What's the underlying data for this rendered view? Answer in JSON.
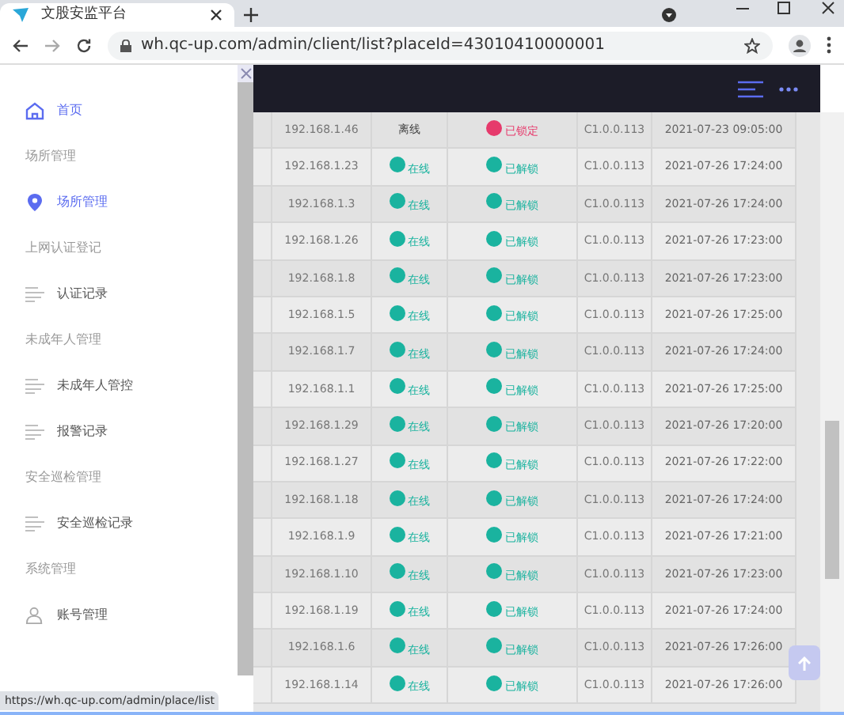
{
  "browser": {
    "tab_title": "文股安监平台",
    "url": "wh.qc-up.com/admin/client/list?placeId=43010410000001",
    "status_url": "https://wh.qc-up.com/admin/place/list"
  },
  "sidebar": {
    "items": [
      {
        "kind": "link",
        "label": "首页",
        "active": true
      },
      {
        "kind": "group",
        "label": "场所管理"
      },
      {
        "kind": "link",
        "label": "场所管理",
        "active": true
      },
      {
        "kind": "group",
        "label": "上网认证登记"
      },
      {
        "kind": "link",
        "label": "认证记录",
        "active": false
      },
      {
        "kind": "group",
        "label": "未成年人管理"
      },
      {
        "kind": "link",
        "label": "未成年人管控",
        "active": false
      },
      {
        "kind": "link",
        "label": "报警记录",
        "active": false
      },
      {
        "kind": "group",
        "label": "安全巡检管理"
      },
      {
        "kind": "link",
        "label": "安全巡检记录",
        "active": false
      },
      {
        "kind": "group",
        "label": "系统管理"
      },
      {
        "kind": "link",
        "label": "账号管理",
        "active": false
      }
    ]
  },
  "table": {
    "rows": [
      {
        "ip": "192.168.1.46",
        "status": "离线",
        "online": false,
        "lock": "已锁定",
        "locked": true,
        "version": "C1.0.0.113",
        "time": "2021-07-23 09:05:00"
      },
      {
        "ip": "192.168.1.23",
        "status": "在线",
        "online": true,
        "lock": "已解锁",
        "locked": false,
        "version": "C1.0.0.113",
        "time": "2021-07-26 17:24:00"
      },
      {
        "ip": "192.168.1.3",
        "status": "在线",
        "online": true,
        "lock": "已解锁",
        "locked": false,
        "version": "C1.0.0.113",
        "time": "2021-07-26 17:24:00"
      },
      {
        "ip": "192.168.1.26",
        "status": "在线",
        "online": true,
        "lock": "已解锁",
        "locked": false,
        "version": "C1.0.0.113",
        "time": "2021-07-26 17:23:00"
      },
      {
        "ip": "192.168.1.8",
        "status": "在线",
        "online": true,
        "lock": "已解锁",
        "locked": false,
        "version": "C1.0.0.113",
        "time": "2021-07-26 17:23:00"
      },
      {
        "ip": "192.168.1.5",
        "status": "在线",
        "online": true,
        "lock": "已解锁",
        "locked": false,
        "version": "C1.0.0.113",
        "time": "2021-07-26 17:25:00"
      },
      {
        "ip": "192.168.1.7",
        "status": "在线",
        "online": true,
        "lock": "已解锁",
        "locked": false,
        "version": "C1.0.0.113",
        "time": "2021-07-26 17:24:00"
      },
      {
        "ip": "192.168.1.1",
        "status": "在线",
        "online": true,
        "lock": "已解锁",
        "locked": false,
        "version": "C1.0.0.113",
        "time": "2021-07-26 17:25:00"
      },
      {
        "ip": "192.168.1.29",
        "status": "在线",
        "online": true,
        "lock": "已解锁",
        "locked": false,
        "version": "C1.0.0.113",
        "time": "2021-07-26 17:20:00"
      },
      {
        "ip": "192.168.1.27",
        "status": "在线",
        "online": true,
        "lock": "已解锁",
        "locked": false,
        "version": "C1.0.0.113",
        "time": "2021-07-26 17:22:00"
      },
      {
        "ip": "192.168.1.18",
        "status": "在线",
        "online": true,
        "lock": "已解锁",
        "locked": false,
        "version": "C1.0.0.113",
        "time": "2021-07-26 17:24:00"
      },
      {
        "ip": "192.168.1.9",
        "status": "在线",
        "online": true,
        "lock": "已解锁",
        "locked": false,
        "version": "C1.0.0.113",
        "time": "2021-07-26 17:21:00"
      },
      {
        "ip": "192.168.1.10",
        "status": "在线",
        "online": true,
        "lock": "已解锁",
        "locked": false,
        "version": "C1.0.0.113",
        "time": "2021-07-26 17:23:00"
      },
      {
        "ip": "192.168.1.19",
        "status": "在线",
        "online": true,
        "lock": "已解锁",
        "locked": false,
        "version": "C1.0.0.113",
        "time": "2021-07-26 17:24:00"
      },
      {
        "ip": "192.168.1.6",
        "status": "在线",
        "online": true,
        "lock": "已解锁",
        "locked": false,
        "version": "C1.0.0.113",
        "time": "2021-07-26 17:26:00"
      },
      {
        "ip": "192.168.1.14",
        "status": "在线",
        "online": true,
        "lock": "已解锁",
        "locked": false,
        "version": "C1.0.0.113",
        "time": "2021-07-26 17:26:00"
      }
    ]
  }
}
